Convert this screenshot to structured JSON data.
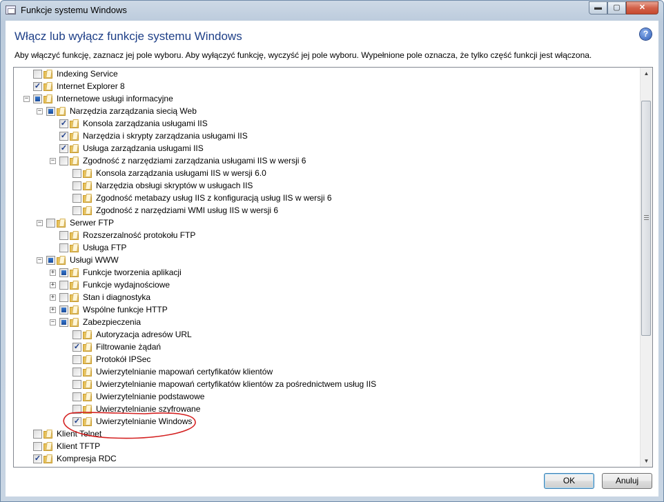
{
  "window": {
    "title": "Funkcje systemu Windows",
    "min_glyph": "▬",
    "max_glyph": "▢",
    "close_glyph": "✕"
  },
  "heading": "Włącz lub wyłącz funkcje systemu Windows",
  "help_glyph": "?",
  "description": "Aby włączyć funkcję, zaznacz jej pole wyboru. Aby wyłączyć funkcję, wyczyść jej pole wyboru. Wypełnione pole oznacza, że tylko część funkcji jest włączona.",
  "features": [
    {
      "label": "Indexing Service",
      "level": 0,
      "expander": "",
      "state": "unchecked"
    },
    {
      "label": "Internet Explorer 8",
      "level": 0,
      "expander": "",
      "state": "checked"
    },
    {
      "label": "Internetowe usługi informacyjne",
      "level": 0,
      "expander": "−",
      "state": "partial"
    },
    {
      "label": "Narzędzia zarządzania siecią Web",
      "level": 1,
      "expander": "−",
      "state": "partial"
    },
    {
      "label": "Konsola zarządzania usługami IIS",
      "level": 2,
      "expander": "",
      "state": "checked"
    },
    {
      "label": "Narzędzia i skrypty zarządzania usługami IIS",
      "level": 2,
      "expander": "",
      "state": "checked"
    },
    {
      "label": "Usługa zarządzania usługami IIS",
      "level": 2,
      "expander": "",
      "state": "checked"
    },
    {
      "label": "Zgodność z narzędziami zarządzania usługami IIS w wersji 6",
      "level": 2,
      "expander": "−",
      "state": "unchecked"
    },
    {
      "label": "Konsola zarządzania usługami IIS w wersji 6.0",
      "level": 3,
      "expander": "",
      "state": "unchecked"
    },
    {
      "label": "Narzędzia obsługi skryptów w usługach IIS",
      "level": 3,
      "expander": "",
      "state": "unchecked"
    },
    {
      "label": "Zgodność metabazy usług IIS z konfiguracją usług IIS w wersji 6",
      "level": 3,
      "expander": "",
      "state": "unchecked"
    },
    {
      "label": "Zgodność z narzędziami WMI usług IIS w wersji 6",
      "level": 3,
      "expander": "",
      "state": "unchecked"
    },
    {
      "label": "Serwer FTP",
      "level": 1,
      "expander": "−",
      "state": "unchecked"
    },
    {
      "label": "Rozszerzalność protokołu FTP",
      "level": 2,
      "expander": "",
      "state": "unchecked"
    },
    {
      "label": "Usługa FTP",
      "level": 2,
      "expander": "",
      "state": "unchecked"
    },
    {
      "label": "Usługi WWW",
      "level": 1,
      "expander": "−",
      "state": "partial"
    },
    {
      "label": "Funkcje tworzenia aplikacji",
      "level": 2,
      "expander": "+",
      "state": "partial"
    },
    {
      "label": "Funkcje wydajnościowe",
      "level": 2,
      "expander": "+",
      "state": "unchecked"
    },
    {
      "label": "Stan i diagnostyka",
      "level": 2,
      "expander": "+",
      "state": "unchecked"
    },
    {
      "label": "Wspólne funkcje HTTP",
      "level": 2,
      "expander": "+",
      "state": "partial"
    },
    {
      "label": "Zabezpieczenia",
      "level": 2,
      "expander": "−",
      "state": "partial"
    },
    {
      "label": "Autoryzacja adresów URL",
      "level": 3,
      "expander": "",
      "state": "unchecked"
    },
    {
      "label": "Filtrowanie żądań",
      "level": 3,
      "expander": "",
      "state": "checked"
    },
    {
      "label": "Protokół IPSec",
      "level": 3,
      "expander": "",
      "state": "unchecked"
    },
    {
      "label": "Uwierzytelnianie mapowań certyfikatów klientów",
      "level": 3,
      "expander": "",
      "state": "unchecked"
    },
    {
      "label": "Uwierzytelnianie mapowań certyfikatów klientów za pośrednictwem usług IIS",
      "level": 3,
      "expander": "",
      "state": "unchecked"
    },
    {
      "label": "Uwierzytelnianie podstawowe",
      "level": 3,
      "expander": "",
      "state": "unchecked"
    },
    {
      "label": "Uwierzytelnianie szyfrowane",
      "level": 3,
      "expander": "",
      "state": "unchecked"
    },
    {
      "label": "Uwierzytelnianie Windows",
      "level": 3,
      "expander": "",
      "state": "checked"
    },
    {
      "label": "Klient Telnet",
      "level": 0,
      "expander": "",
      "state": "unchecked"
    },
    {
      "label": "Klient TFTP",
      "level": 0,
      "expander": "",
      "state": "unchecked"
    },
    {
      "label": "Kompresja RDC",
      "level": 0,
      "expander": "",
      "state": "checked"
    },
    {
      "label": "",
      "level": 0,
      "expander": "",
      "state": "unchecked"
    }
  ],
  "scrollbar": {
    "up_glyph": "▲",
    "down_glyph": "▼"
  },
  "buttons": {
    "ok": "OK",
    "cancel": "Anuluj"
  },
  "colors": {
    "heading": "#1e3f87",
    "annotation": "#d42020"
  }
}
